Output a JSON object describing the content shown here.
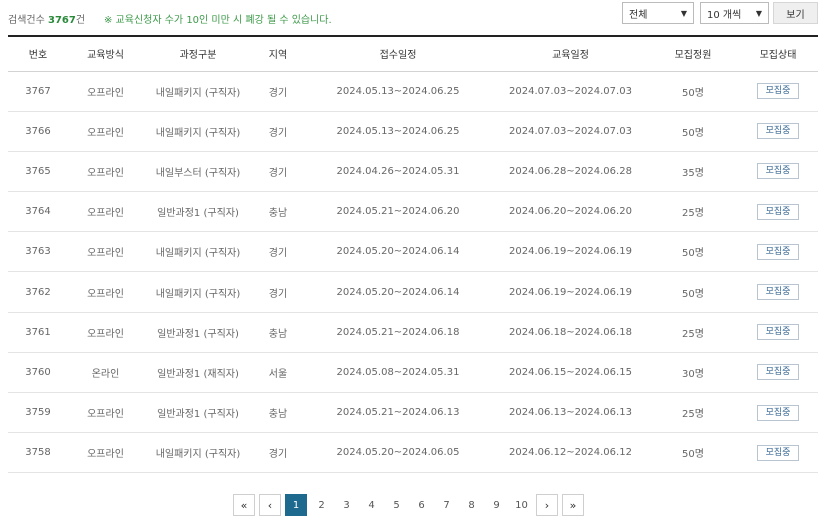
{
  "summary": {
    "label": "검색건수",
    "count": "3767",
    "unit": "건",
    "notice": "※ 교육신청자 수가 10인 미만 시 폐강 될 수 있습니다."
  },
  "filters": {
    "region": "전체",
    "page_size": "10 개씩",
    "view_button": "보기"
  },
  "table": {
    "headers": [
      "번호",
      "교육방식",
      "과정구분",
      "지역",
      "접수일정",
      "교육일정",
      "모집정원",
      "모집상태"
    ],
    "rows": [
      [
        "3767",
        "오프라인",
        "내일패키지 (구직자)",
        "경기",
        "2024.05.13~2024.06.25",
        "2024.07.03~2024.07.03",
        "50명",
        "모집중"
      ],
      [
        "3766",
        "오프라인",
        "내일패키지 (구직자)",
        "경기",
        "2024.05.13~2024.06.25",
        "2024.07.03~2024.07.03",
        "50명",
        "모집중"
      ],
      [
        "3765",
        "오프라인",
        "내일부스터 (구직자)",
        "경기",
        "2024.04.26~2024.05.31",
        "2024.06.28~2024.06.28",
        "35명",
        "모집중"
      ],
      [
        "3764",
        "오프라인",
        "일반과정1 (구직자)",
        "충남",
        "2024.05.21~2024.06.20",
        "2024.06.20~2024.06.20",
        "25명",
        "모집중"
      ],
      [
        "3763",
        "오프라인",
        "내일패키지 (구직자)",
        "경기",
        "2024.05.20~2024.06.14",
        "2024.06.19~2024.06.19",
        "50명",
        "모집중"
      ],
      [
        "3762",
        "오프라인",
        "내일패키지 (구직자)",
        "경기",
        "2024.05.20~2024.06.14",
        "2024.06.19~2024.06.19",
        "50명",
        "모집중"
      ],
      [
        "3761",
        "오프라인",
        "일반과정1 (구직자)",
        "충남",
        "2024.05.21~2024.06.18",
        "2024.06.18~2024.06.18",
        "25명",
        "모집중"
      ],
      [
        "3760",
        "온라인",
        "일반과정1 (재직자)",
        "서울",
        "2024.05.08~2024.05.31",
        "2024.06.15~2024.06.15",
        "30명",
        "모집중"
      ],
      [
        "3759",
        "오프라인",
        "일반과정1 (구직자)",
        "충남",
        "2024.05.21~2024.06.13",
        "2024.06.13~2024.06.13",
        "25명",
        "모집중"
      ],
      [
        "3758",
        "오프라인",
        "내일패키지 (구직자)",
        "경기",
        "2024.05.20~2024.06.05",
        "2024.06.12~2024.06.12",
        "50명",
        "모집중"
      ]
    ]
  },
  "pagination": {
    "first": "«",
    "prev": "‹",
    "pages": [
      "1",
      "2",
      "3",
      "4",
      "5",
      "6",
      "7",
      "8",
      "9",
      "10"
    ],
    "current": "1",
    "next": "›",
    "last": "»"
  }
}
